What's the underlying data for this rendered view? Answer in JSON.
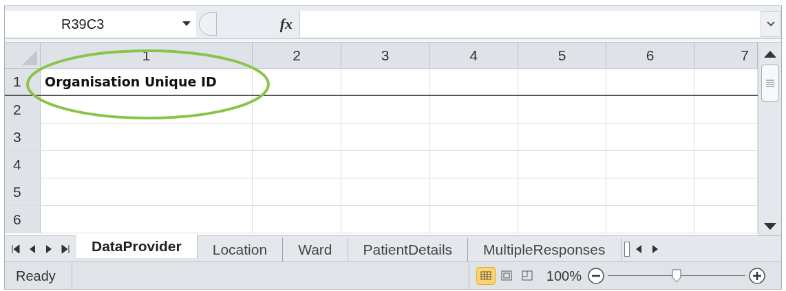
{
  "name_box": {
    "value": "R39C3"
  },
  "formula_bar": {
    "fx": "fx"
  },
  "columns": [
    "1",
    "2",
    "3",
    "4",
    "5",
    "6",
    "7"
  ],
  "rows": [
    {
      "header": "1",
      "cells": [
        "Organisation Unique ID",
        "",
        "",
        "",
        "",
        "",
        ""
      ]
    },
    {
      "header": "2",
      "cells": [
        "",
        "",
        "",
        "",
        "",
        "",
        ""
      ]
    },
    {
      "header": "3",
      "cells": [
        "",
        "",
        "",
        "",
        "",
        "",
        ""
      ]
    },
    {
      "header": "4",
      "cells": [
        "",
        "",
        "",
        "",
        "",
        "",
        ""
      ]
    },
    {
      "header": "5",
      "cells": [
        "",
        "",
        "",
        "",
        "",
        "",
        ""
      ]
    },
    {
      "header": "6",
      "cells": [
        "",
        "",
        "",
        "",
        "",
        "",
        ""
      ]
    }
  ],
  "sheet_tabs": [
    {
      "label": "DataProvider",
      "selected": true
    },
    {
      "label": "Location",
      "selected": false
    },
    {
      "label": "Ward",
      "selected": false
    },
    {
      "label": "PatientDetails",
      "selected": false
    },
    {
      "label": "MultipleResponses",
      "selected": false
    }
  ],
  "status_bar": {
    "status": "Ready",
    "views": [
      {
        "kind": "normal",
        "selected": true
      },
      {
        "kind": "layout",
        "selected": false
      },
      {
        "kind": "break",
        "selected": false
      }
    ],
    "zoom": {
      "reading": "100%",
      "level": 0.5
    }
  }
}
